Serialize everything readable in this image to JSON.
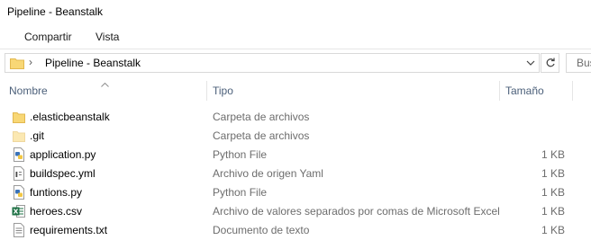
{
  "window": {
    "title": "Pipeline - Beanstalk"
  },
  "ribbon": {
    "tabs": [
      {
        "label": "Compartir"
      },
      {
        "label": "Vista"
      }
    ]
  },
  "address": {
    "separator": "›",
    "path": "Pipeline - Beanstalk"
  },
  "search": {
    "placeholder": "Bus"
  },
  "columns": {
    "name": "Nombre",
    "type": "Tipo",
    "size": "Tamaño"
  },
  "files": [
    {
      "name": ".elasticbeanstalk",
      "type": "Carpeta de archivos",
      "size": "",
      "icon": "folder-icon"
    },
    {
      "name": ".git",
      "type": "Carpeta de archivos",
      "size": "",
      "icon": "folder-icon"
    },
    {
      "name": "application.py",
      "type": "Python File",
      "size": "1 KB",
      "icon": "python-file-icon"
    },
    {
      "name": "buildspec.yml",
      "type": "Archivo de origen Yaml",
      "size": "1 KB",
      "icon": "yaml-file-icon"
    },
    {
      "name": "funtions.py",
      "type": "Python File",
      "size": "1 KB",
      "icon": "python-file-icon"
    },
    {
      "name": "heroes.csv",
      "type": "Archivo de valores separados por comas de Microsoft Excel",
      "size": "1 KB",
      "icon": "excel-file-icon"
    },
    {
      "name": "requirements.txt",
      "type": "Documento de texto",
      "size": "1 KB",
      "icon": "text-file-icon"
    }
  ]
}
